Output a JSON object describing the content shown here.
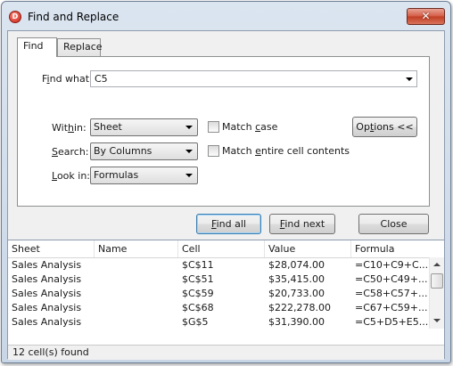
{
  "window": {
    "title": "Find and Replace",
    "close_glyph": "✕",
    "app_icon_letter": "D"
  },
  "tabs": [
    {
      "label": "Find",
      "selected": true
    },
    {
      "label": "Replace",
      "selected": false
    }
  ],
  "find_what": {
    "label_pre": "F",
    "label_u": "i",
    "label_post": "nd what:",
    "value": "C5"
  },
  "within": {
    "label_pre": "Wit",
    "label_u": "h",
    "label_post": "in:",
    "value": "Sheet"
  },
  "search": {
    "label_pre": "",
    "label_u": "S",
    "label_post": "earch:",
    "value": "By Columns"
  },
  "look_in": {
    "label_pre": "",
    "label_u": "L",
    "label_post": "ook in:",
    "value": "Formulas"
  },
  "match_case": {
    "label_pre": "Match ",
    "label_u": "c",
    "label_post": "ase",
    "checked": false
  },
  "match_entire": {
    "label_pre": "Match ",
    "label_u": "e",
    "label_post": "ntire cell contents",
    "checked": false
  },
  "options_button": {
    "label_pre": "Op",
    "label_u": "t",
    "label_post": "ions <<"
  },
  "find_all_button": {
    "label_pre": "",
    "label_u": "F",
    "label_post": "ind all"
  },
  "find_next_button": {
    "label_pre": "",
    "label_u": "F",
    "label_post": "ind next"
  },
  "close_button": {
    "label": "Close"
  },
  "results": {
    "columns": [
      "Sheet",
      "Name",
      "Cell",
      "Value",
      "Formula"
    ],
    "rows": [
      {
        "sheet": "Sales Analysis",
        "name": "",
        "cell": "$C$11",
        "value": "$28,074.00",
        "formula": "=C10+C9+C..."
      },
      {
        "sheet": "Sales Analysis",
        "name": "",
        "cell": "$C$51",
        "value": "$35,415.00",
        "formula": "=C50+C49+..."
      },
      {
        "sheet": "Sales Analysis",
        "name": "",
        "cell": "$C$59",
        "value": "$20,733.00",
        "formula": "=C58+C57+..."
      },
      {
        "sheet": "Sales Analysis",
        "name": "",
        "cell": "$C$68",
        "value": "$222,278.00",
        "formula": "=C67+C59+..."
      },
      {
        "sheet": "Sales Analysis",
        "name": "",
        "cell": "$G$5",
        "value": "$31,390.00",
        "formula": "=C5+D5+E5..."
      }
    ],
    "status": "12 cell(s) found"
  }
}
